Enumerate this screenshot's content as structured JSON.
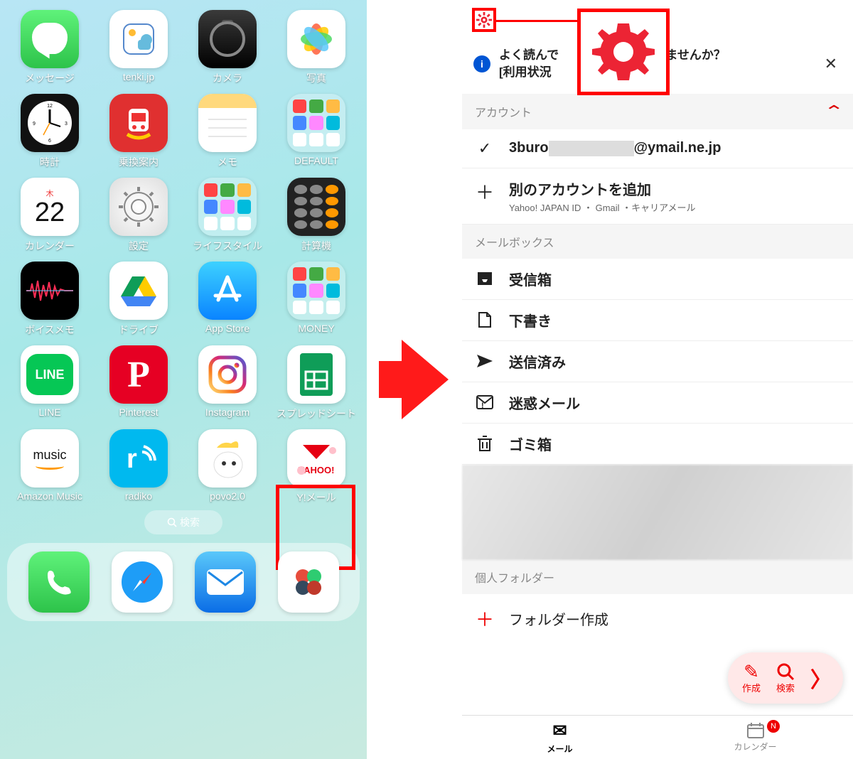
{
  "home": {
    "calendar_weekday": "木",
    "calendar_day": "22",
    "music_label": "music",
    "line_label": "LINE",
    "pinterest_letter": "P",
    "search_label": "検索",
    "apps": [
      {
        "label": "メッセージ"
      },
      {
        "label": "tenki.jp"
      },
      {
        "label": "カメラ"
      },
      {
        "label": "写真"
      },
      {
        "label": "時計"
      },
      {
        "label": "乗換案内"
      },
      {
        "label": "メモ"
      },
      {
        "label": "DEFAULT"
      },
      {
        "label": "カレンダー"
      },
      {
        "label": "設定"
      },
      {
        "label": "ライフスタイル"
      },
      {
        "label": "計算機"
      },
      {
        "label": "ボイスメモ"
      },
      {
        "label": "ドライブ"
      },
      {
        "label": "App Store"
      },
      {
        "label": "MONEY"
      },
      {
        "label": "LINE"
      },
      {
        "label": "Pinterest"
      },
      {
        "label": "Instagram"
      },
      {
        "label": "スプレッドシート"
      },
      {
        "label": "Amazon Music"
      },
      {
        "label": "radiko"
      },
      {
        "label": "povo2.0"
      },
      {
        "label": "Y!メール"
      }
    ]
  },
  "mail": {
    "banner_line1": "よく読んで",
    "banner_line1b": "整理しませんか？",
    "banner_line2": "[利用状況",
    "account_section": "アカウント",
    "account_user": "3buro",
    "account_domain": "@ymail.ne.jp",
    "add_account": "別のアカウントを追加",
    "add_account_sub": "Yahoo! JAPAN ID ・ Gmail ・キャリアメール",
    "mailbox_section": "メールボックス",
    "boxes": {
      "inbox": "受信箱",
      "drafts": "下書き",
      "sent": "送信済み",
      "spam": "迷惑メール",
      "trash": "ゴミ箱"
    },
    "personal_section": "個人フォルダー",
    "create_folder": "フォルダー作成",
    "fab_compose": "作成",
    "fab_search": "検索",
    "tab_mail": "メール",
    "tab_calendar": "カレンダー",
    "tab_badge": "N"
  }
}
